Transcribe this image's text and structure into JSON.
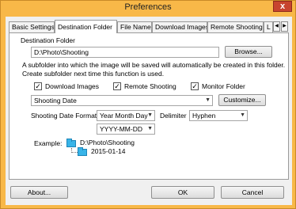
{
  "window": {
    "title": "Preferences",
    "close": "x"
  },
  "tabs": [
    {
      "label": "Basic Settings"
    },
    {
      "label": "Destination Folder",
      "active": true
    },
    {
      "label": "File Name"
    },
    {
      "label": "Download Images"
    },
    {
      "label": "Remote Shooting"
    },
    {
      "label": "L"
    }
  ],
  "tab_scroll": {
    "left": "◀",
    "right": "▶"
  },
  "destination": {
    "label": "Destination Folder",
    "path": "D:\\Photo\\Shooting",
    "browse": "Browse..."
  },
  "subfolder_info": {
    "line1": "A subfolder into which the image will be saved will automatically be created in this folder.",
    "line2": "Create subfolder next time this function is used."
  },
  "checkboxes": [
    {
      "label": "Download Images",
      "checked": true
    },
    {
      "label": "Remote Shooting",
      "checked": true
    },
    {
      "label": "Monitor Folder",
      "checked": true
    }
  ],
  "check_mark": "✓",
  "subfolder_type": {
    "value": "Shooting Date",
    "customize": "Customize..."
  },
  "date_format": {
    "label": "Shooting Date Format",
    "value": "Year Month Day",
    "delimiter_label": "Delimiter",
    "delimiter_value": "Hyphen",
    "pattern": "YYYY-MM-DD"
  },
  "example": {
    "label": "Example:",
    "folder": "D:\\Photo\\Shooting",
    "subfolder": "2015-01-14"
  },
  "buttons": {
    "about": "About...",
    "ok": "OK",
    "cancel": "Cancel"
  },
  "dropdown_arrow": "▼",
  "colors": {
    "frame": "#f8b848",
    "close": "#c7442f",
    "folder": "#38b4e8"
  }
}
